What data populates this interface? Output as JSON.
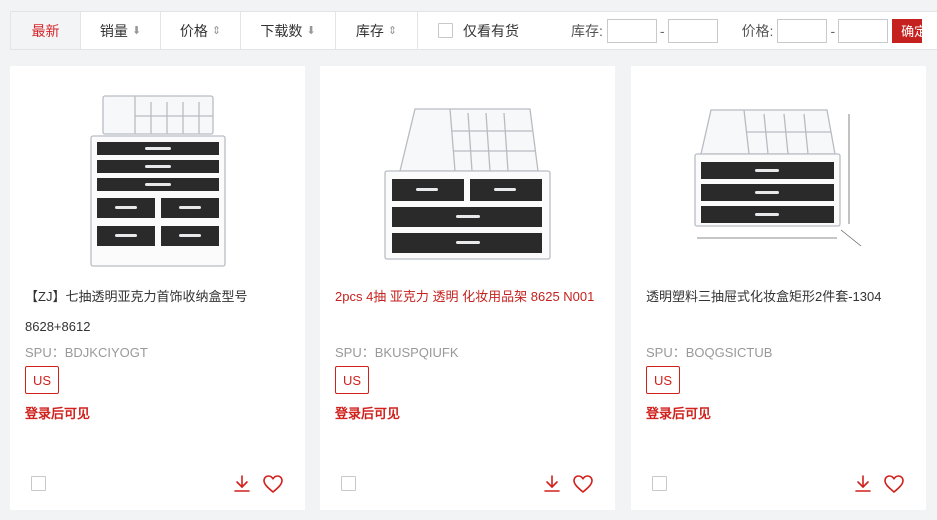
{
  "sort_bar": {
    "tabs": [
      {
        "label": "最新",
        "arrow": ""
      },
      {
        "label": "销量",
        "arrow": "⬇"
      },
      {
        "label": "价格",
        "arrow": "⇕"
      },
      {
        "label": "下载数",
        "arrow": "⬇"
      },
      {
        "label": "库存",
        "arrow": "⇕"
      }
    ],
    "in_stock_label": "仅看有货",
    "stock_range_label": "库存:",
    "stock_min": "",
    "stock_max": "",
    "price_range_label": "价格:",
    "price_min": "",
    "price_max": "",
    "range_dash": "-",
    "confirm_label": "确定"
  },
  "products": [
    {
      "title": "【ZJ】七抽透明亚克力首饰收纳盒型号8628+8612",
      "spu": "SPU：BDJKCIYOGT",
      "region": "US",
      "price_notice": "登录后可见"
    },
    {
      "title": "2pcs 4抽 亚克力 透明 化妆用品架 8625 N001",
      "spu": "SPU：BKUSPQIUFK",
      "region": "US",
      "price_notice": "登录后可见"
    },
    {
      "title": "透明塑料三抽屉式化妆盒矩形2件套-1304",
      "spu": "SPU：BOQGSICTUB",
      "region": "US",
      "price_notice": "登录后可见"
    }
  ],
  "colors": {
    "accent": "#d0211c",
    "background": "#f2f3f5"
  }
}
